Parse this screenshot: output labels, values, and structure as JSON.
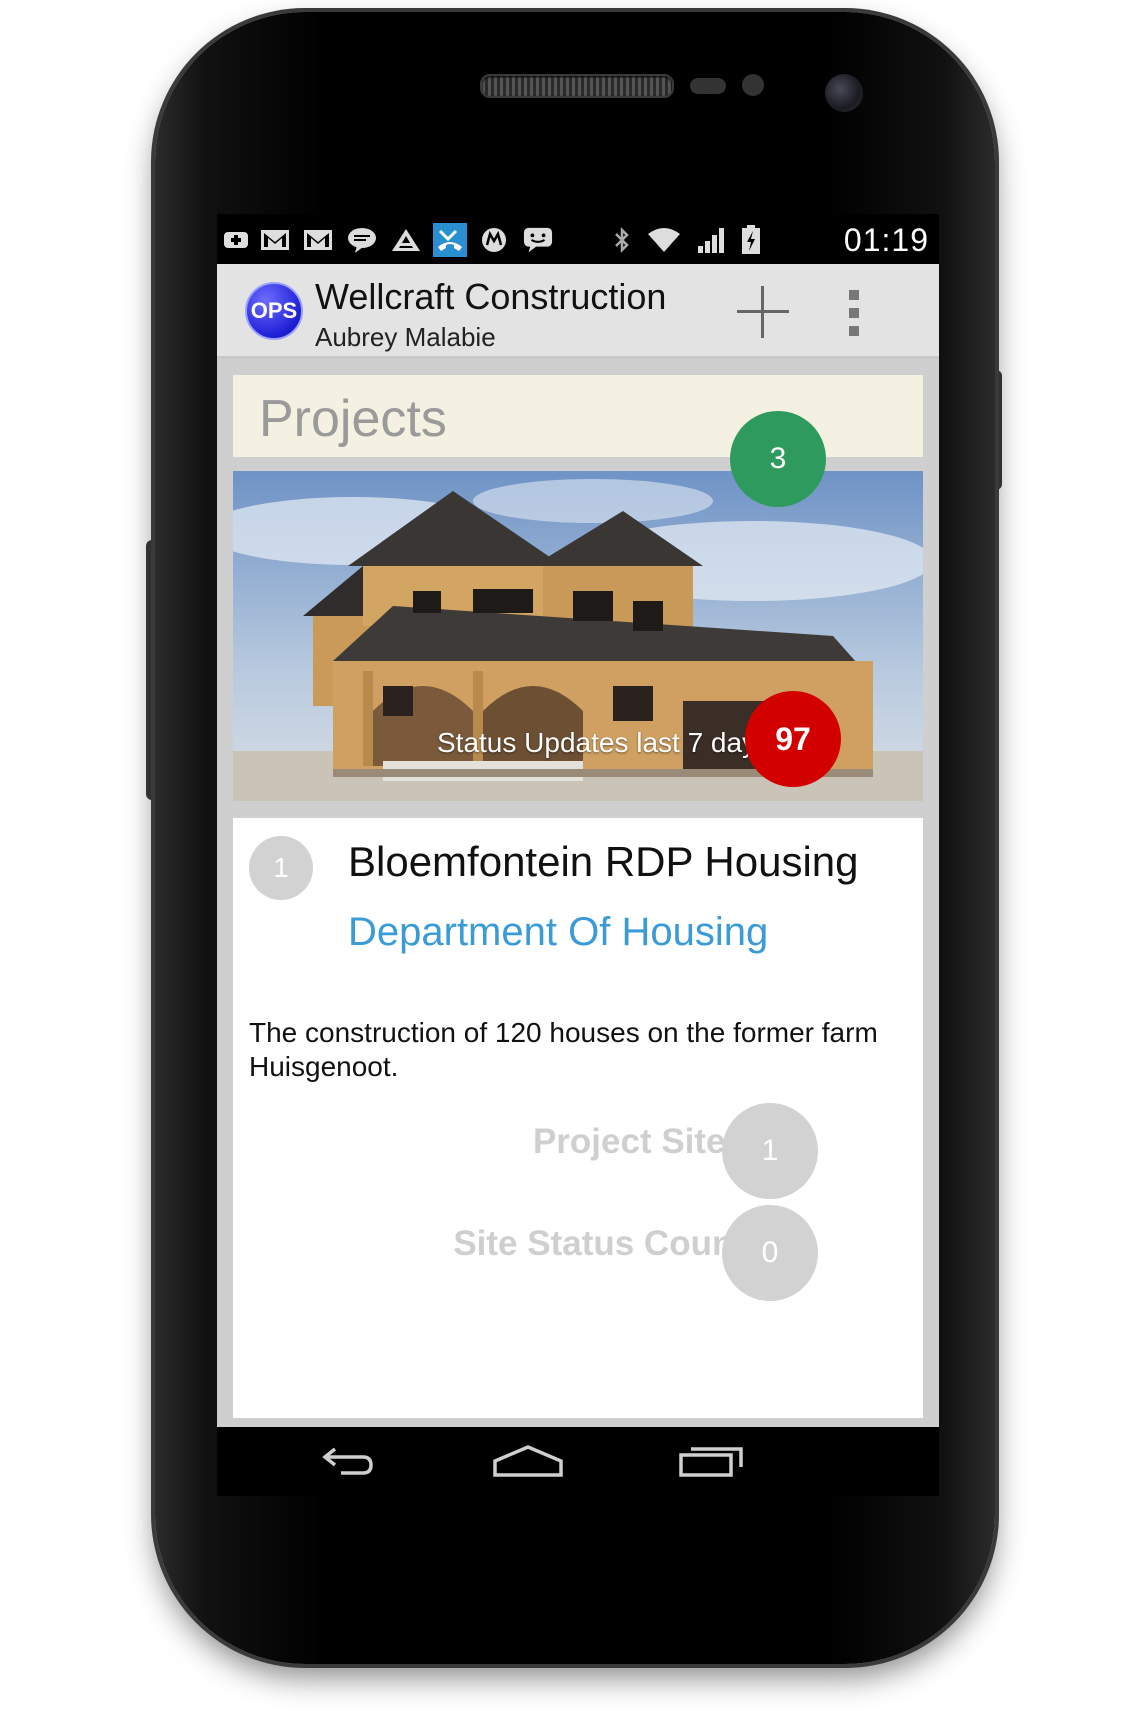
{
  "status_bar": {
    "time": "01:19",
    "notification_icons": [
      "plus-box-icon",
      "gmail-icon",
      "gmail-icon",
      "chat-bubble-icon",
      "ascent-icon",
      "missed-call-icon",
      "motorola-icon",
      "messaging-icon"
    ],
    "system_icons": [
      "bluetooth-icon",
      "wifi-icon",
      "signal-icon",
      "battery-icon"
    ]
  },
  "action_bar": {
    "logo_text": "OPS",
    "title": "Wellcraft Construction",
    "subtitle": "Aubrey Malabie"
  },
  "projects": {
    "header_title": "Projects",
    "count": "3",
    "status_updates_label": "Status Updates last 7 days",
    "status_updates_count": "97"
  },
  "project_card": {
    "rank": "1",
    "name": "Bloemfontein RDP Housing",
    "client": "Department Of Housing",
    "description": "The construction of 120 houses on the former farm Huisgenoot.",
    "metrics": [
      {
        "label": "Project Sites",
        "value": "1"
      },
      {
        "label": "Site Status Count",
        "value": "0"
      }
    ]
  },
  "colors": {
    "count_badge": "#2e9a5e",
    "status_badge": "#d30000",
    "client_link": "#3a9bd6",
    "header_bg": "#f5f1e2"
  }
}
